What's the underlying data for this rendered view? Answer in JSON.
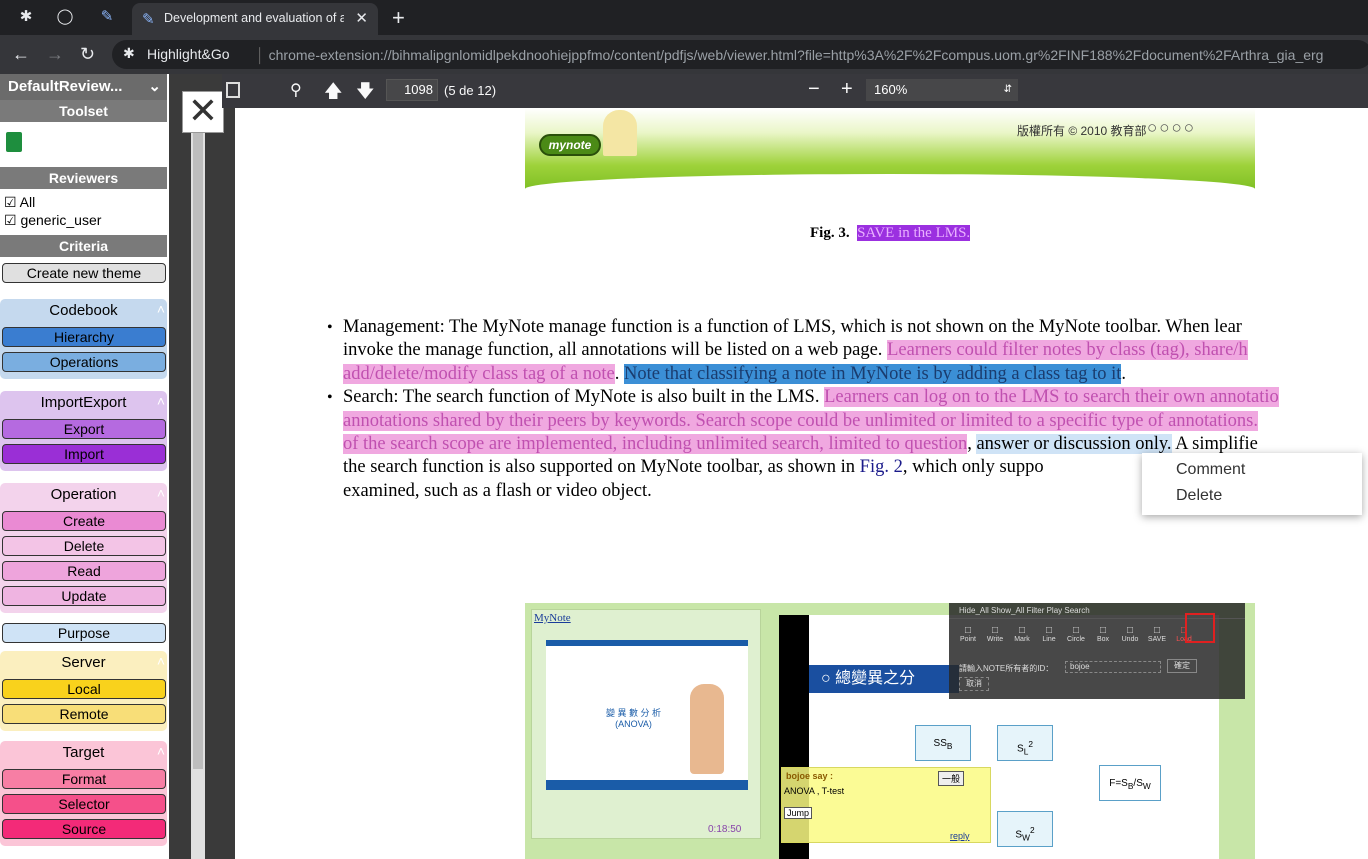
{
  "browser": {
    "active_tab_title": "Development and evaluation of a",
    "site_name": "Highlight&Go",
    "url": "chrome-extension://bihmalipgnlomidlpekdnoohiejppfmo/content/pdfjs/web/viewer.html?file=http%3A%2F%2Fcompus.uom.gr%2FINF188%2Fdocument%2FArthra_gia_erg"
  },
  "sidebar": {
    "title": "DefaultReview...",
    "toolset": "Toolset",
    "reviewers_header": "Reviewers",
    "reviewers": [
      "All",
      "generic_user"
    ],
    "criteria_header": "Criteria",
    "create_theme": "Create new theme",
    "groups": [
      {
        "name": "Codebook",
        "color": "#c5d9ee",
        "items": [
          {
            "label": "Hierarchy",
            "color": "#3a7dd0"
          },
          {
            "label": "Operations",
            "color": "#7aaee0"
          }
        ]
      },
      {
        "name": "ImportExport",
        "color": "#ddc4ee",
        "items": [
          {
            "label": "Export",
            "color": "#b56ae0"
          },
          {
            "label": "Import",
            "color": "#9a2fd6"
          }
        ]
      },
      {
        "name": "Operation",
        "color": "#f3d3ec",
        "items": [
          {
            "label": "Create",
            "color": "#ea8ad3"
          },
          {
            "label": "Delete",
            "color": "#f3c4e6"
          },
          {
            "label": "Read",
            "color": "#eea4dc"
          },
          {
            "label": "Update",
            "color": "#efb4e1"
          }
        ]
      },
      {
        "name": "Purpose",
        "color": "#cfe3f6",
        "items": []
      },
      {
        "name": "Server",
        "color": "#fbefbf",
        "items": [
          {
            "label": "Local",
            "color": "#f9d21c"
          },
          {
            "label": "Remote",
            "color": "#f8de78"
          }
        ]
      },
      {
        "name": "Target",
        "color": "#fbc5d7",
        "items": [
          {
            "label": "Format",
            "color": "#f77ea4"
          },
          {
            "label": "Selector",
            "color": "#f5508a"
          },
          {
            "label": "Source",
            "color": "#f32a78"
          }
        ]
      }
    ]
  },
  "pdf_toolbar": {
    "page": "1098",
    "page_count": "(5 de 12)",
    "zoom": "160%"
  },
  "document": {
    "fig_label": "Fig. 3.",
    "fig_caption": "SAVE in the LMS.",
    "copyright": "版權所有 © 2010 教育部",
    "logo": "mynote",
    "bullets": [
      [
        {
          "t": "Management: The MyNote manage function is a function of LMS, which is not shown on the MyNote toolbar. When lear"
        }
      ],
      [
        {
          "t": "invoke the manage function, all annotations will be listed on a web page. "
        },
        {
          "t": "Learners could ",
          "c": "hp"
        },
        {
          "t": "filter notes by class (tag), share/h",
          "c": "hp"
        }
      ],
      [
        {
          "t": "add/delete/modify class tag of a note",
          "c": "hp"
        },
        {
          "t": ". "
        },
        {
          "t": "Note that classifying a note in MyNote is by adding a class tag to it",
          "c": "hb"
        },
        {
          "t": "."
        }
      ],
      [
        {
          "t": "Search: The search function of MyNote is also built in the LMS. "
        },
        {
          "t": "Learners can log on to the LMS to search their own annotatio",
          "c": "hp"
        }
      ],
      [
        {
          "t": "annotations shared by their peers by keywords. Search scope could be unlimited or limited to a specific type of annotations.",
          "c": "hp"
        }
      ],
      [
        {
          "t": "of the search scope are implemented, including unlimited search, limited to question",
          "c": "hp"
        },
        {
          "t": ", "
        },
        {
          "t": "answer or discussion only.",
          "c": "hl"
        },
        {
          "t": " A simplifie"
        }
      ],
      [
        {
          "t": "the search function is also supported on MyNote toolbar, as shown in "
        },
        {
          "t": "Fig. 2",
          "c": "lnk"
        },
        {
          "t": ", which only suppo"
        }
      ],
      [
        {
          "t": "examined, such as a flash or video object."
        }
      ]
    ],
    "screenshot": {
      "mynote_link": "MyNote",
      "video_title": "變 異 數 分 析",
      "video_sub": "(ANOVA)",
      "time": "0:18:50",
      "toolbar_menu": "Hide_All  Show_All  Filter  Play  Search",
      "tools": [
        "Point",
        "Write",
        "Mark",
        "Line",
        "Circle",
        "Box",
        "Undo",
        "SAVE",
        "Load"
      ],
      "id_prompt": "請輸入NOTE所有者的ID：",
      "id_value": "bojoe",
      "confirm": "確定",
      "cancel": "取消",
      "slide_title": "總變異之分",
      "note_author": "bojoe say :",
      "note_text": "ANOVA , T-test",
      "note_jump": "Jump",
      "note_reply": "reply",
      "note_dropdown": "一般"
    }
  },
  "context_menu": [
    "Comment",
    "Delete"
  ]
}
